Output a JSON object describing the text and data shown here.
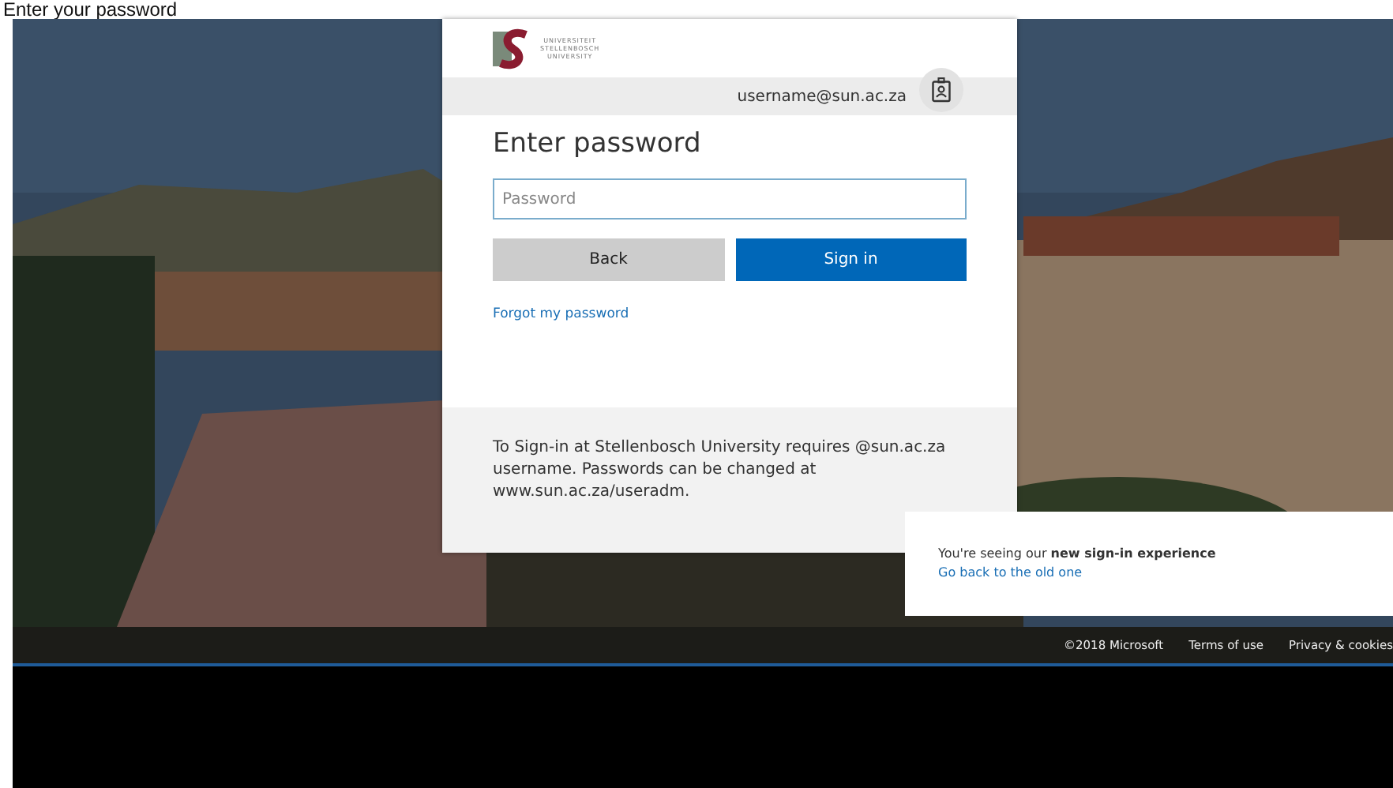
{
  "caption": "Enter your password",
  "dialog": {
    "logo_lines": [
      "UNIVERSITEIT",
      "STELLENBOSCH",
      "UNIVERSITY"
    ],
    "username": "username@sun.ac.za",
    "title": "Enter password",
    "password": {
      "placeholder": "Password"
    },
    "buttons": [
      {
        "label": "Back",
        "kind": "secondary"
      },
      {
        "label": "Sign in",
        "kind": "primary"
      }
    ],
    "forgot_link": "Forgot my password",
    "notice": "To Sign-in at Stellenbosch University requires @sun.ac.za username. Passwords can be changed at www.sun.ac.za/useradm."
  },
  "toast": {
    "message": "You're seeing our **new sign-in experience**",
    "link": "Go back to the old one"
  },
  "footer": [
    "©2018 Microsoft",
    "Terms of use",
    "Privacy & cookies"
  ]
}
